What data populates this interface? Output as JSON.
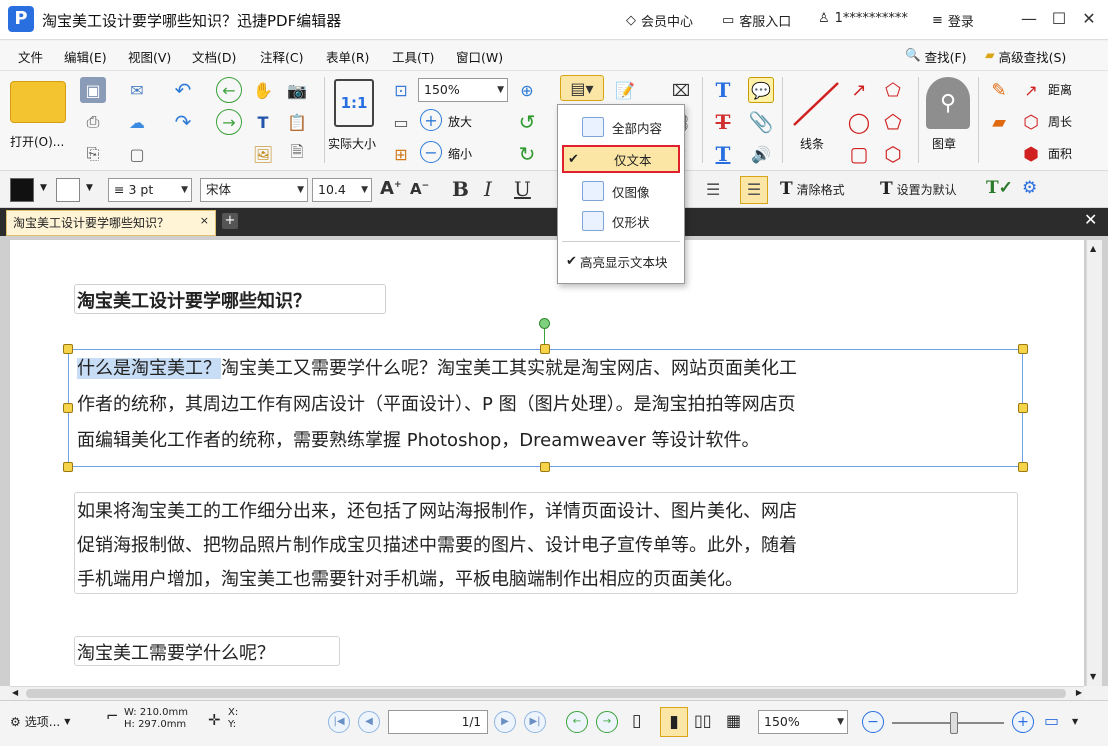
{
  "titlebar": {
    "app_title": "淘宝美工设计要学哪些知识？迅捷PDF编辑器",
    "member_center": "会员中心",
    "customer_service": "客服入口",
    "user_name": "1**********",
    "login": "登录"
  },
  "menu": [
    "文件",
    "编辑(E)",
    "视图(V)",
    "文档(D)",
    "注释(C)",
    "表单(R)",
    "工具(T)",
    "窗口(W)"
  ],
  "menu_right": {
    "search": "查找(F)",
    "advanced_search": "高级查找(S)"
  },
  "ribbon": {
    "open_label": "打开(O)...",
    "actual_size_label": "实际大小",
    "zoom_value": "150%",
    "zoom_in": "放大",
    "zoom_out": "缩小",
    "line_label": "线条",
    "stamp_label": "图章",
    "distance": "距离",
    "perimeter": "周长",
    "area": "面积"
  },
  "format": {
    "line_width": "3 pt",
    "font": "宋体",
    "font_size": "10.4",
    "clear_format": "清除格式",
    "set_default": "设置为默认"
  },
  "tab": {
    "title": "淘宝美工设计要学哪些知识？"
  },
  "dropdown": {
    "items": [
      "全部内容",
      "仅文本",
      "仅图像",
      "仅形状"
    ],
    "highlight_label": "高亮显示文本块",
    "selected": "仅文本"
  },
  "document": {
    "heading1": "淘宝美工设计要学哪些知识？",
    "para1_selected": "什么是淘宝美工？",
    "para1_line1_rest": "淘宝美工又需要学什么呢？淘宝美工其实就是淘宝网店、网站页面美化工",
    "para1_line2": "作者的统称，其周边工作有网店设计（平面设计）、P 图（图片处理）。是淘宝拍拍等网店页",
    "para1_line3": "面编辑美化工作者的统称，需要熟练掌握 Photoshop，Dreamweaver 等设计软件。",
    "para2_line1": "如果将淘宝美工的工作细分出来，还包括了网站海报制作，详情页面设计、图片美化、网店",
    "para2_line2": "促销海报制做、把物品照片制作成宝贝描述中需要的图片、设计电子宣传单等。此外，随着",
    "para2_line3": "手机端用户增加，淘宝美工也需要针对手机端，平板电脑端制作出相应的页面美化。",
    "heading2": "淘宝美工需要学什么呢？"
  },
  "status": {
    "select_label": "选项...",
    "width": "W: 210.0mm",
    "height": "H: 297.0mm",
    "x_label": "X:",
    "y_label": "Y:",
    "page_value": "1/1",
    "zoom_value": "150%"
  },
  "colors": {
    "accent": "#2a6fe0",
    "highlight_box": "#e0202b",
    "selection": "#c7dcf5",
    "tab_bg": "#fff4d6"
  }
}
